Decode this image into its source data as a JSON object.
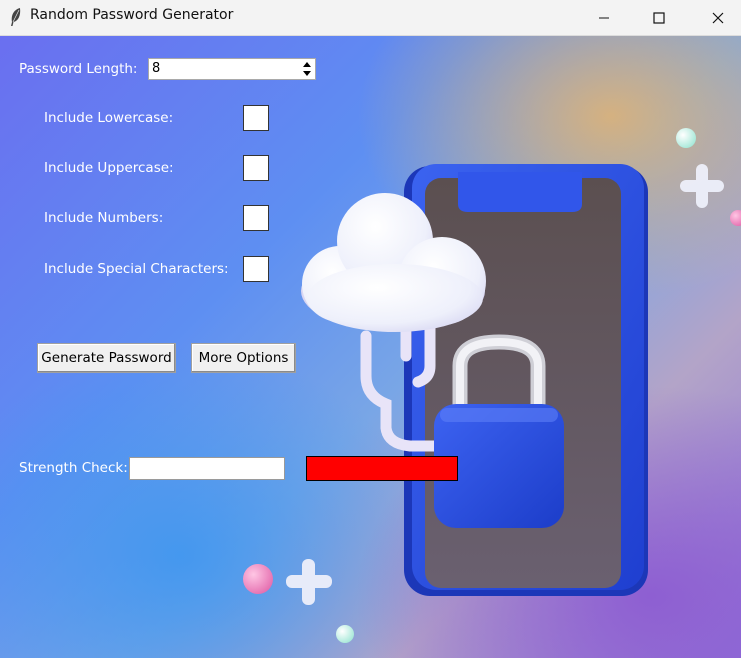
{
  "window": {
    "title": "Random Password Generator",
    "app_icon": "feather-icon",
    "controls": [
      "minimize-icon",
      "maximize-icon",
      "close-icon"
    ]
  },
  "form": {
    "length_label": "Password Length:",
    "length_value": "8",
    "options": [
      {
        "label": "Include Lowercase:",
        "checked": false
      },
      {
        "label": "Include Uppercase:",
        "checked": false
      },
      {
        "label": "Include Numbers:",
        "checked": false
      },
      {
        "label": "Include Special Characters:",
        "checked": false
      }
    ],
    "generate_button": "Generate Password",
    "more_options_button": "More Options",
    "strength_label": "Strength Check:",
    "password_output": "",
    "strength_color": "#ff0000"
  },
  "colors": {
    "phone_frame": "#2f55e6",
    "lock_body": "#2b4fd8",
    "strength_fill": "#ff0000"
  }
}
